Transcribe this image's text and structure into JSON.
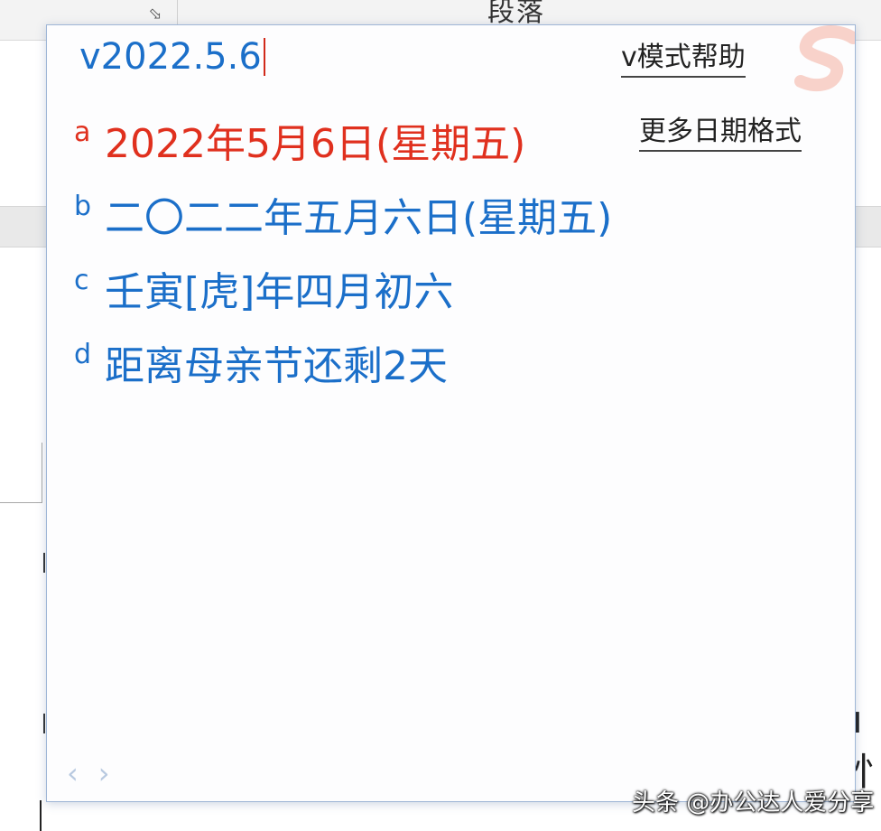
{
  "document": {
    "ribbon": {
      "group_label": "段落",
      "expander_icon": "dialog-launcher-icon"
    },
    "right_char": "ı忄"
  },
  "ime": {
    "input": {
      "value": "v2022.5.6"
    },
    "help_link": "v模式帮助",
    "more_formats_link": "更多日期格式",
    "candidates": [
      {
        "key": "a",
        "text": "2022年5月6日(星期五)",
        "selected": true
      },
      {
        "key": "b",
        "text": "二〇二二年五月六日(星期五)",
        "selected": false
      },
      {
        "key": "c",
        "text": "壬寅[虎]年四月初六",
        "selected": false
      },
      {
        "key": "d",
        "text": "距离母亲节还剩2天",
        "selected": false
      }
    ],
    "pager": {
      "prev": "‹",
      "next": "›"
    },
    "logo_icon": "sogou-s-logo-icon"
  },
  "watermark": "头条 @办公达人爱分享",
  "colors": {
    "accent": "#1b6fc9",
    "selected": "#e0301e",
    "panel_border": "#9fb6d6"
  }
}
